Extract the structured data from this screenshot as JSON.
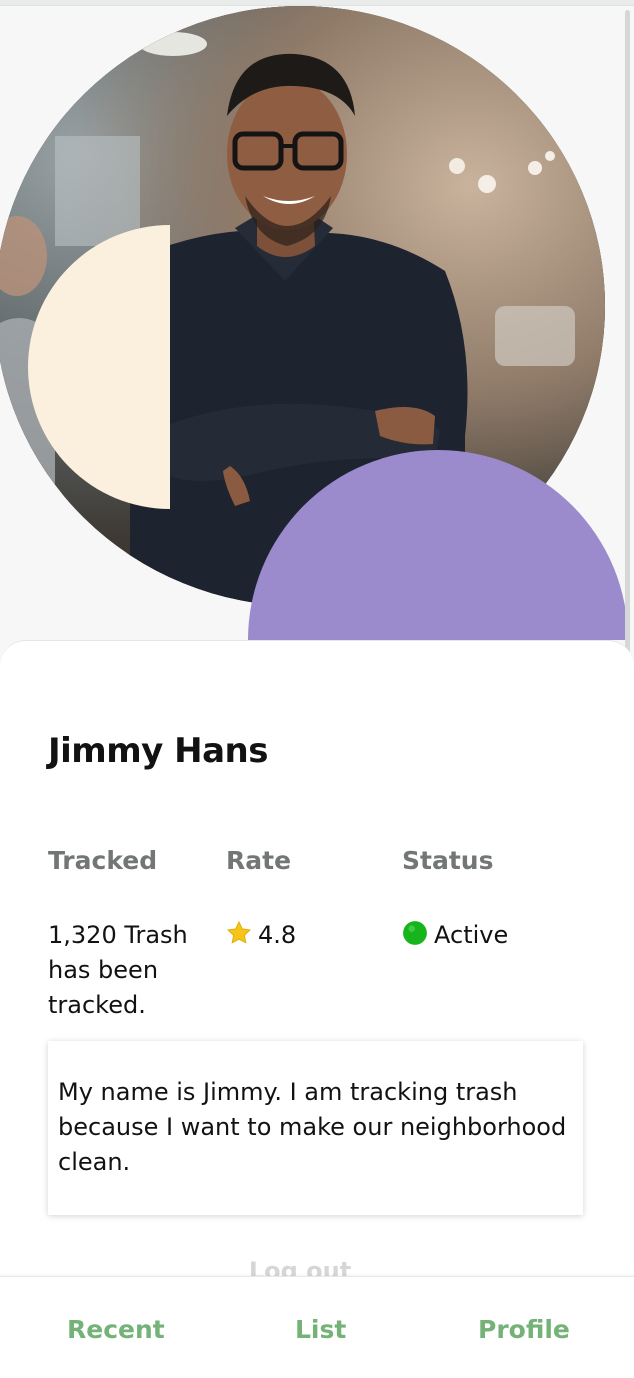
{
  "profile": {
    "name": "Jimmy Hans",
    "stats": {
      "tracked_label": "Tracked",
      "rate_label": "Rate",
      "status_label": "Status",
      "tracked_value": "1,320 Trash has been tracked.",
      "rate_value": "4.8",
      "status_value": "Active"
    },
    "bio": "My name is Jimmy. I am tracking trash because I want to make our neighborhood clean.",
    "logout_label": "Log out"
  },
  "nav": {
    "recent": "Recent",
    "list": "List",
    "profile": "Profile"
  },
  "icons": {
    "rate": "star-icon",
    "status": "green-circle-icon"
  },
  "colors": {
    "accent_green": "#74b278",
    "purple": "#9b8bcc",
    "cream": "#fbefde",
    "status_green": "#18b41e",
    "star": "#f5c518"
  }
}
